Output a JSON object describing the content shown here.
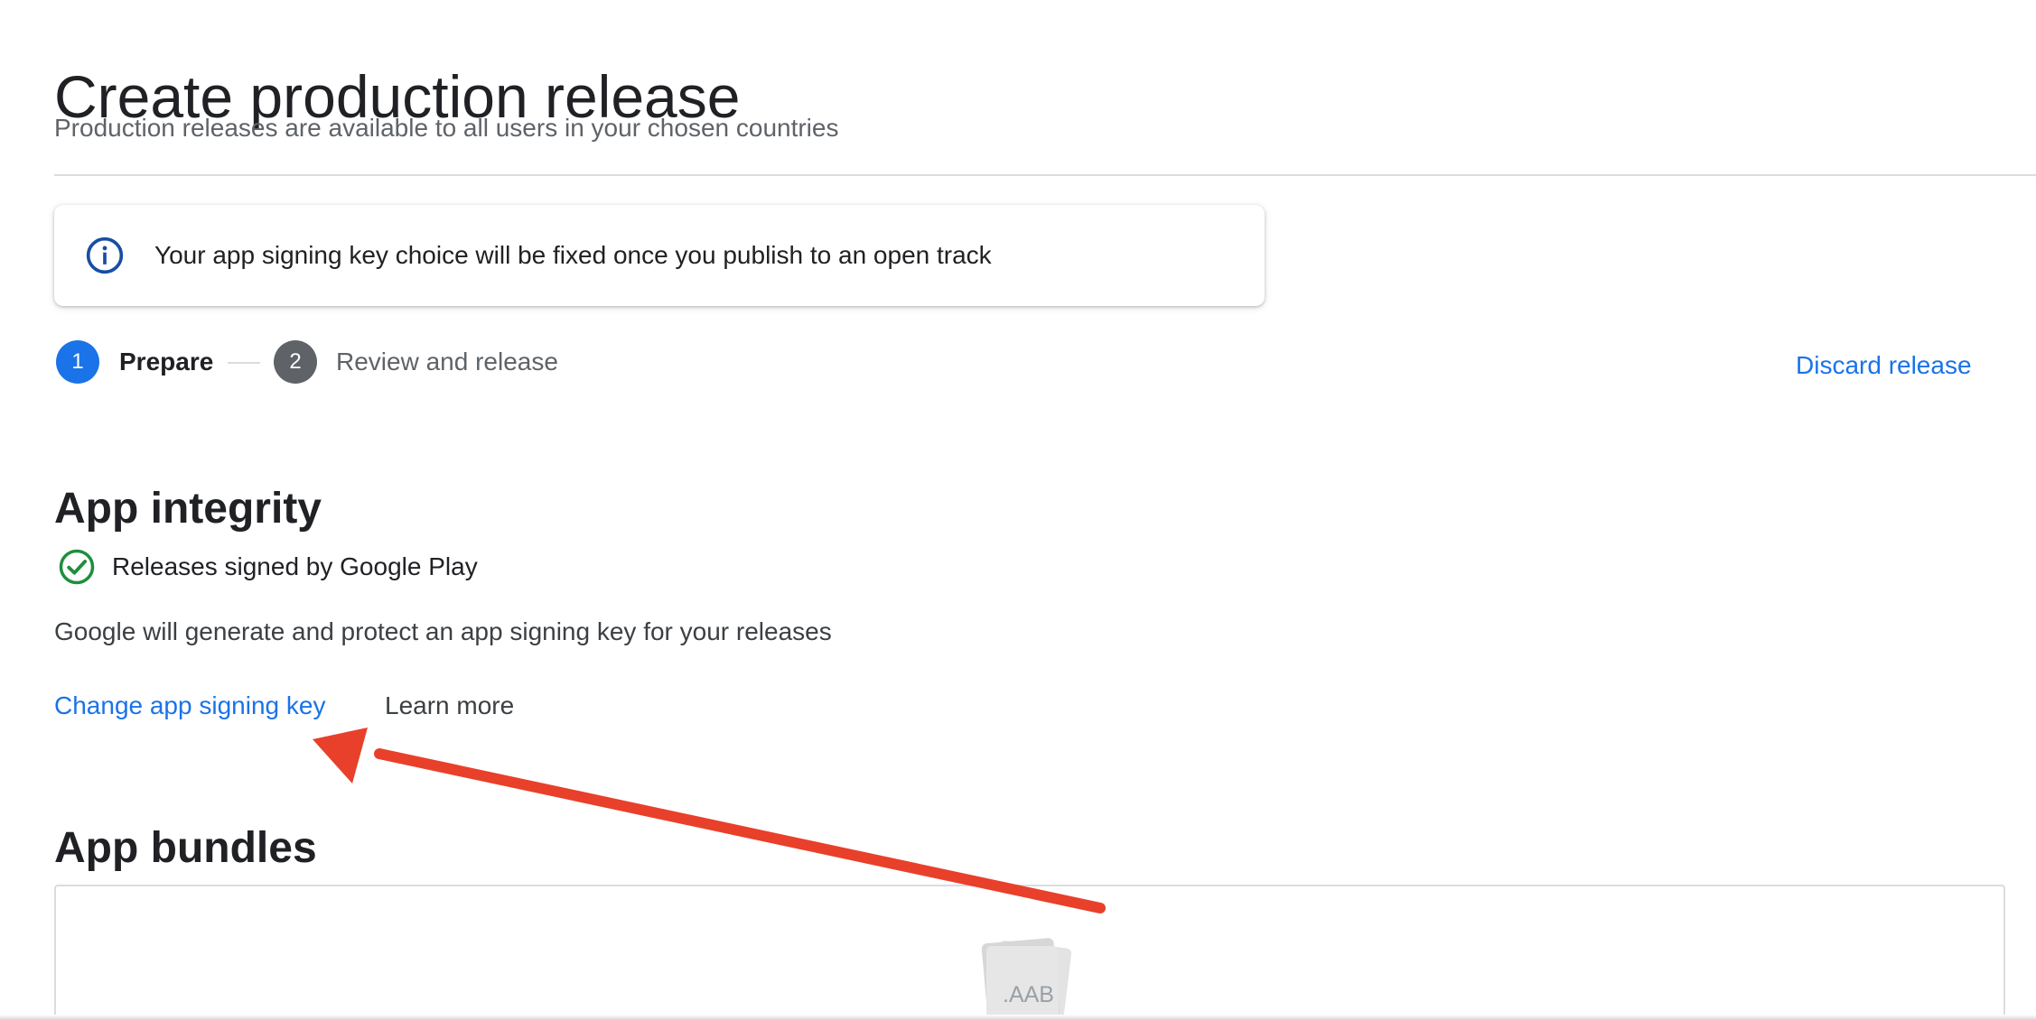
{
  "header": {
    "title": "Create production release",
    "subtitle": "Production releases are available to all users in your chosen countries"
  },
  "info_banner": {
    "icon": "info-icon",
    "text": "Your app signing key choice will be fixed once you publish to an open track"
  },
  "stepper": {
    "steps": [
      {
        "number": "1",
        "label": "Prepare",
        "active": true
      },
      {
        "number": "2",
        "label": "Review and release",
        "active": false
      }
    ]
  },
  "actions": {
    "discard_label": "Discard release"
  },
  "app_integrity": {
    "title": "App integrity",
    "status_icon": "check-circle-icon",
    "status_text": "Releases signed by Google Play",
    "description": "Google will generate and protect an app signing key for your releases",
    "change_key_label": "Change app signing key",
    "learn_more_label": "Learn more"
  },
  "app_bundles": {
    "title": "App bundles",
    "file_icon_label": ".AAB"
  },
  "annotation": {
    "type": "red-arrow",
    "points_to": "change-app-signing-key-link",
    "color": "#e8402a"
  },
  "colors": {
    "primary": "#1a73e8",
    "success": "#1e8e3e",
    "info_icon": "#174ea6",
    "step_inactive": "#5f6368",
    "divider": "#dadce0"
  }
}
